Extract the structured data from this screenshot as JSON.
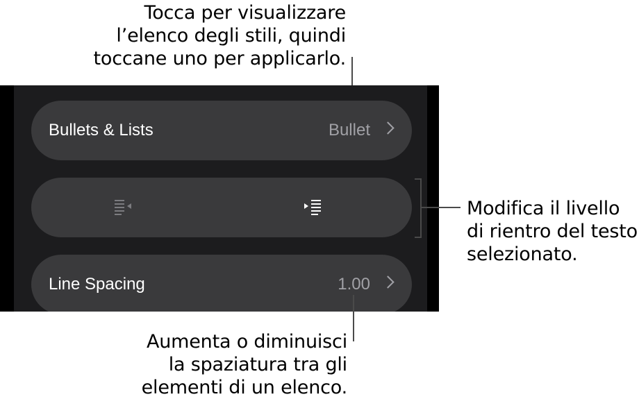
{
  "callouts": {
    "top": [
      "Tocca per visualizzare",
      "l’elenco degli stili, quindi",
      "toccane uno per applicarlo."
    ],
    "right": [
      "Modifica il livello",
      "di rientro del testo",
      "selezionato."
    ],
    "bottom": [
      "Aumenta o diminuisci",
      "la spaziatura tra gli",
      "elementi di un elenco."
    ]
  },
  "panel": {
    "bullets_row": {
      "label": "Bullets & Lists",
      "value": "Bullet"
    },
    "indent_row": {
      "decrease_icon": "outdent-icon",
      "increase_icon": "indent-icon",
      "decrease_enabled": false,
      "increase_enabled": true
    },
    "spacing_row": {
      "label": "Line Spacing",
      "value": "1.00"
    }
  },
  "colors": {
    "panel_bg": "#1c1c1e",
    "row_bg": "#3a3a3c",
    "secondary_text": "#a1a1a6",
    "disabled_icon": "#7c7c80"
  }
}
